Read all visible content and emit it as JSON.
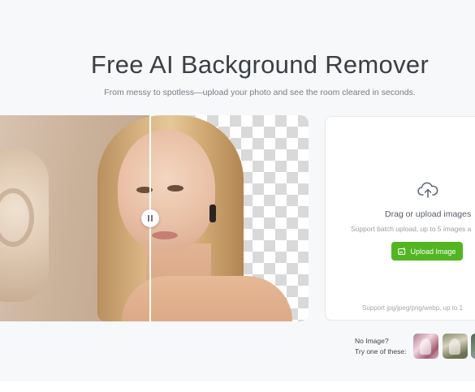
{
  "header": {
    "title": "Free AI Background Remover",
    "subtitle": "From messy to spotless—upload your photo and see the room cleared in seconds."
  },
  "hero": {
    "slider_icon": "pause-bars-icon"
  },
  "upload": {
    "icon": "cloud-upload-icon",
    "drag_text": "Drag or upload images",
    "batch_text": "Support batch upload, up to 5 images a",
    "button_label": "Upload Image",
    "button_icon": "image-upload-icon",
    "formats_text": "Support jpg/jpeg/png/webp, up to 1",
    "accent_color": "#52b521"
  },
  "samples": {
    "no_image": "No Image?",
    "try_one": "Try one of these:"
  }
}
